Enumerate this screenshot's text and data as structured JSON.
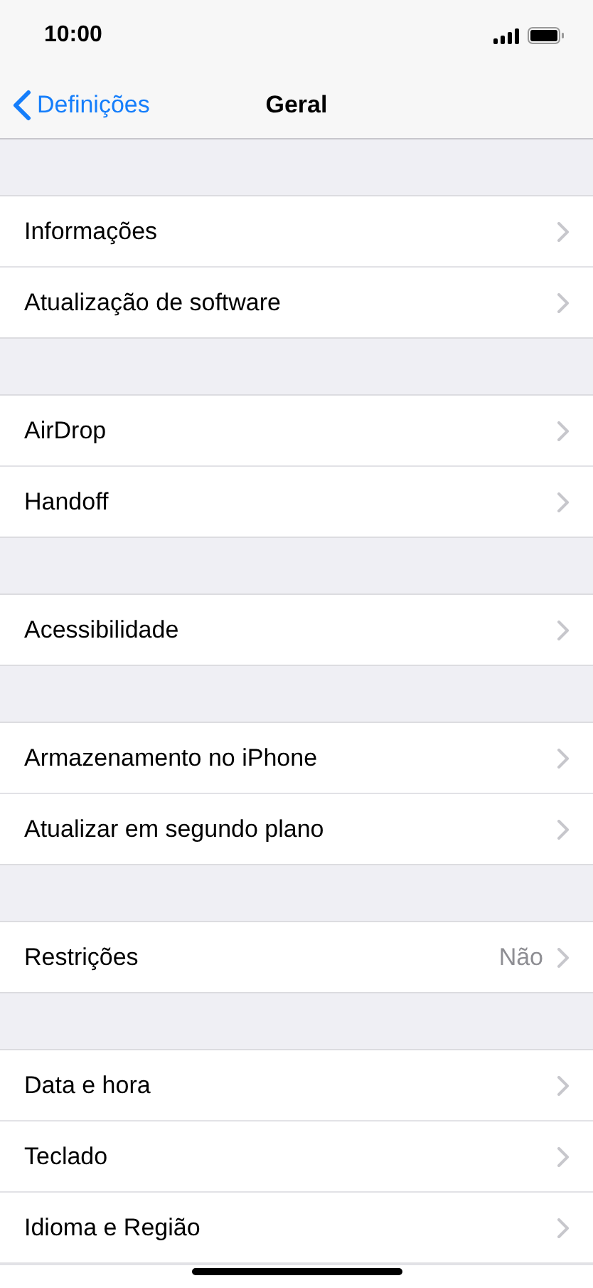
{
  "status_bar": {
    "time": "10:00"
  },
  "nav_bar": {
    "back": "Definições",
    "title": "Geral"
  },
  "groups": [
    {
      "rows": [
        {
          "label": "Informações"
        },
        {
          "label": "Atualização de software"
        }
      ]
    },
    {
      "rows": [
        {
          "label": "AirDrop"
        },
        {
          "label": "Handoff"
        }
      ]
    },
    {
      "rows": [
        {
          "label": "Acessibilidade"
        }
      ]
    },
    {
      "rows": [
        {
          "label": "Armazenamento no iPhone"
        },
        {
          "label": "Atualizar em segundo plano"
        }
      ]
    },
    {
      "rows": [
        {
          "label": "Restrições",
          "value": "Não"
        }
      ]
    },
    {
      "rows": [
        {
          "label": "Data e hora"
        },
        {
          "label": "Teclado"
        },
        {
          "label": "Idioma e Região"
        }
      ]
    }
  ]
}
